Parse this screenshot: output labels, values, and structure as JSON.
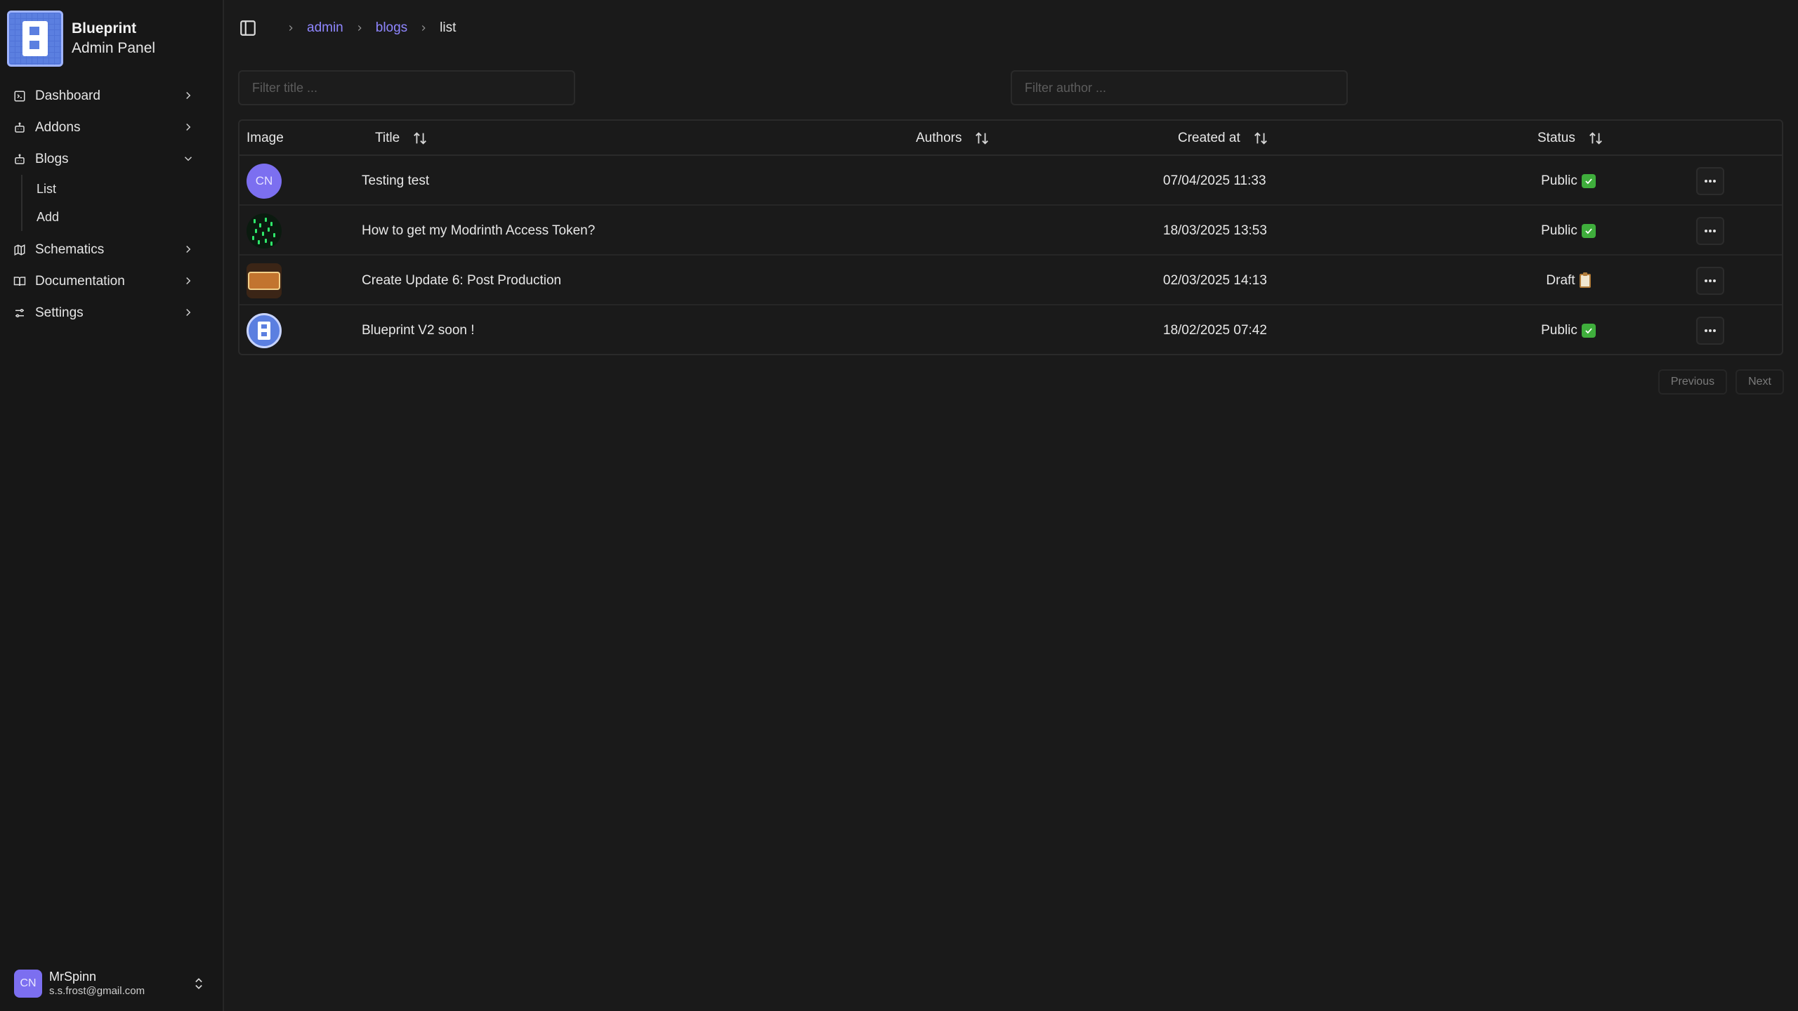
{
  "brand": {
    "name": "Blueprint",
    "subtitle": "Admin Panel"
  },
  "sidebar": {
    "items": [
      {
        "label": "Dashboard",
        "icon": "terminal-icon",
        "expanded": false
      },
      {
        "label": "Addons",
        "icon": "bot-icon",
        "expanded": false
      },
      {
        "label": "Blogs",
        "icon": "bot-icon",
        "expanded": true,
        "children": [
          "List",
          "Add"
        ]
      },
      {
        "label": "Schematics",
        "icon": "map-icon",
        "expanded": false
      },
      {
        "label": "Documentation",
        "icon": "book-open-icon",
        "expanded": false
      },
      {
        "label": "Settings",
        "icon": "sliders-icon",
        "expanded": false
      }
    ]
  },
  "user": {
    "initials": "CN",
    "name": "MrSpinn",
    "email": "s.s.frost@gmail.com"
  },
  "breadcrumb": {
    "items": [
      "admin",
      "blogs"
    ],
    "current": "list"
  },
  "filters": {
    "title_placeholder": "Filter title ...",
    "author_placeholder": "Filter author ..."
  },
  "table": {
    "columns": {
      "image": "Image",
      "title": "Title",
      "authors": "Authors",
      "created_at": "Created at",
      "status": "Status"
    },
    "rows": [
      {
        "image": "CN",
        "image_kind": "initials",
        "title": "Testing test",
        "authors": "",
        "created_at": "07/04/2025 11:33",
        "status": "Public",
        "status_icon": "check-icon"
      },
      {
        "image": "",
        "image_kind": "matrix",
        "title": "How to get my Modrinth Access Token?",
        "authors": "",
        "created_at": "18/03/2025 13:53",
        "status": "Public",
        "status_icon": "check-icon"
      },
      {
        "image": "",
        "image_kind": "create",
        "title": "Create Update 6: Post Production",
        "authors": "",
        "created_at": "02/03/2025 14:13",
        "status": "Draft",
        "status_icon": "clipboard-icon"
      },
      {
        "image": "",
        "image_kind": "blueprint",
        "title": "Blueprint V2 soon !",
        "authors": "",
        "created_at": "18/02/2025 07:42",
        "status": "Public",
        "status_icon": "check-icon"
      }
    ]
  },
  "pagination": {
    "previous": "Previous",
    "next": "Next"
  },
  "colors": {
    "accent": "#8f86ff",
    "avatar": "#7c6ff0",
    "background": "#1a1a1a",
    "sidebar": "#171717",
    "status_public": "#3fae3c"
  }
}
